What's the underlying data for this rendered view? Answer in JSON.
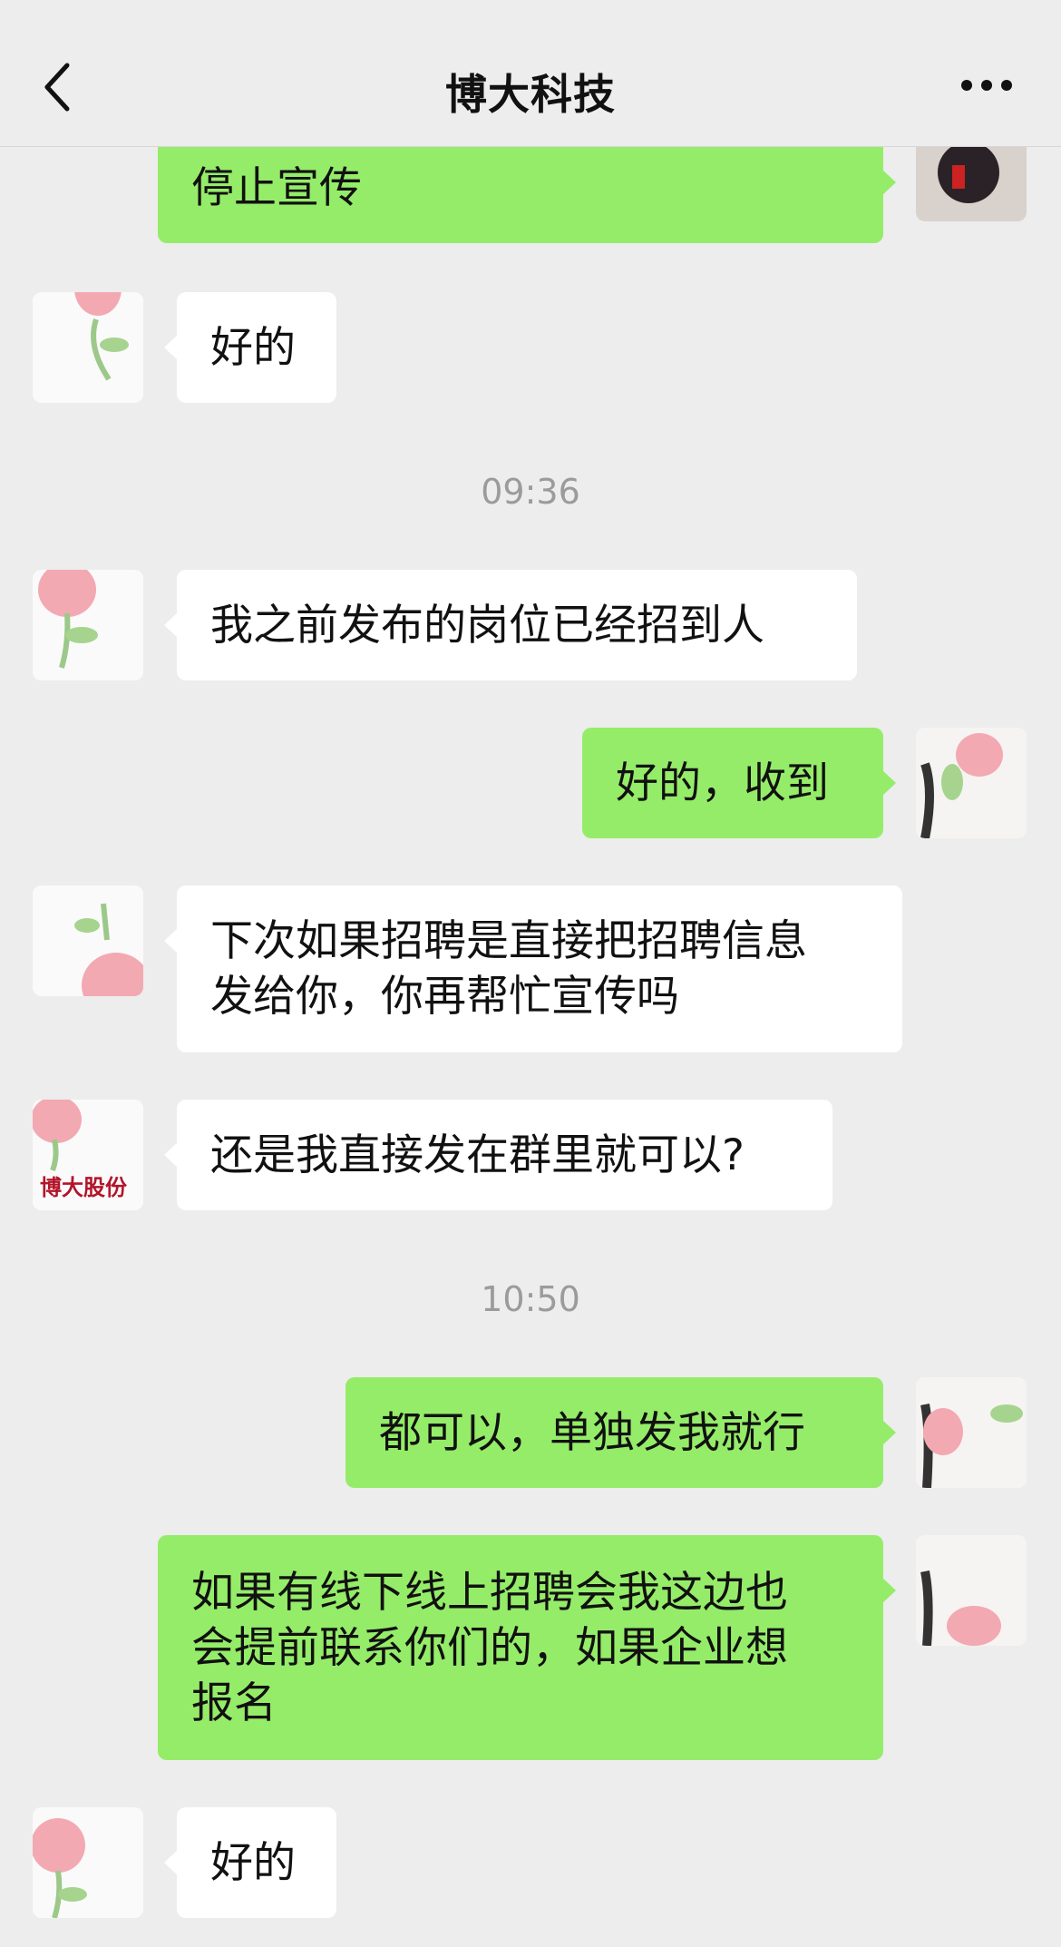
{
  "header": {
    "title": "博大科技",
    "back_icon": "chevron-left-icon",
    "more_icon": "more-dots-icon"
  },
  "colors": {
    "background": "#ededed",
    "incoming_bubble": "#ffffff",
    "outgoing_bubble": "#95ec69",
    "timestamp": "#9b9b9b"
  },
  "messages": [
    {
      "side": "right",
      "text": "停止宣传"
    },
    {
      "side": "left",
      "text": "好的"
    },
    {
      "type": "time",
      "text": "09:36"
    },
    {
      "side": "left",
      "text": "我之前发布的岗位已经招到人"
    },
    {
      "side": "right",
      "text": "好的，收到"
    },
    {
      "side": "left",
      "text": "下次如果招聘是直接把招聘信息\n发给你，你再帮忙宣传吗"
    },
    {
      "side": "left",
      "text": "还是我直接发在群里就可以?"
    },
    {
      "type": "time",
      "text": "10:50"
    },
    {
      "side": "right",
      "text": "都可以，单独发我就行"
    },
    {
      "side": "right",
      "text": "如果有线下线上招聘会我这边也\n会提前联系你们的，如果企业想\n报名"
    },
    {
      "side": "left",
      "text": "好的"
    }
  ],
  "avatar_caption": "博大股份"
}
